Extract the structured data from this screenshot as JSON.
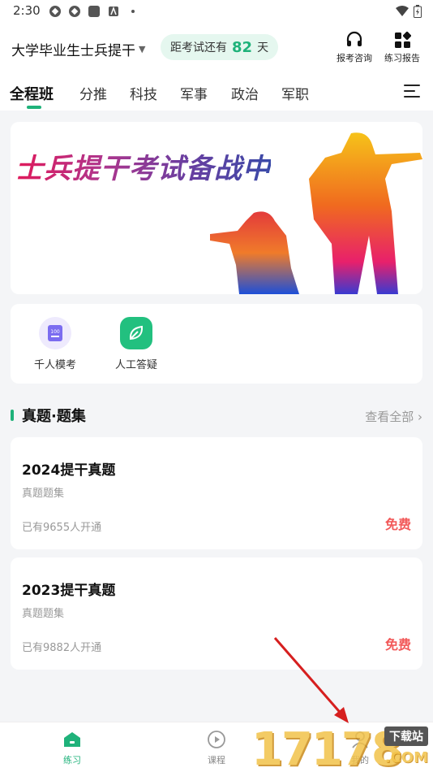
{
  "status_bar": {
    "time": "2:30"
  },
  "header": {
    "exam_title": "大学毕业生士兵提干",
    "countdown_prefix": "距考试还有",
    "countdown_days": "82",
    "countdown_suffix": "天",
    "consult_label": "报考咨询",
    "report_label": "练习报告"
  },
  "tabs": [
    "全程班",
    "分推",
    "科技",
    "军事",
    "政治",
    "军职"
  ],
  "banner": {
    "text": "士兵提干考试备战中"
  },
  "quick_actions": [
    {
      "label": "千人模考",
      "icon": "exam-paper-icon",
      "color": "#7b6cf0"
    },
    {
      "label": "人工答疑",
      "icon": "leaf-icon",
      "color": "#22c07f"
    }
  ],
  "section": {
    "title": "真题·题集",
    "view_all": "查看全部"
  },
  "question_sets": [
    {
      "title": "2024提干真题",
      "subtitle": "真题题集",
      "count": "已有9655人开通",
      "price": "免费"
    },
    {
      "title": "2023提干真题",
      "subtitle": "真题题集",
      "count": "已有9882人开通",
      "price": "免费"
    }
  ],
  "bottom_nav": [
    {
      "label": "练习",
      "icon": "home-icon",
      "active": true
    },
    {
      "label": "课程",
      "icon": "play-icon",
      "active": false
    },
    {
      "label": "我的",
      "icon": "user-icon",
      "active": false
    }
  ],
  "watermark": {
    "number": "17178",
    "badge": "下载站",
    "domain": ".COM"
  },
  "colors": {
    "accent": "#1fb27a",
    "price": "#f25a5a",
    "background": "#f4f5f7"
  }
}
